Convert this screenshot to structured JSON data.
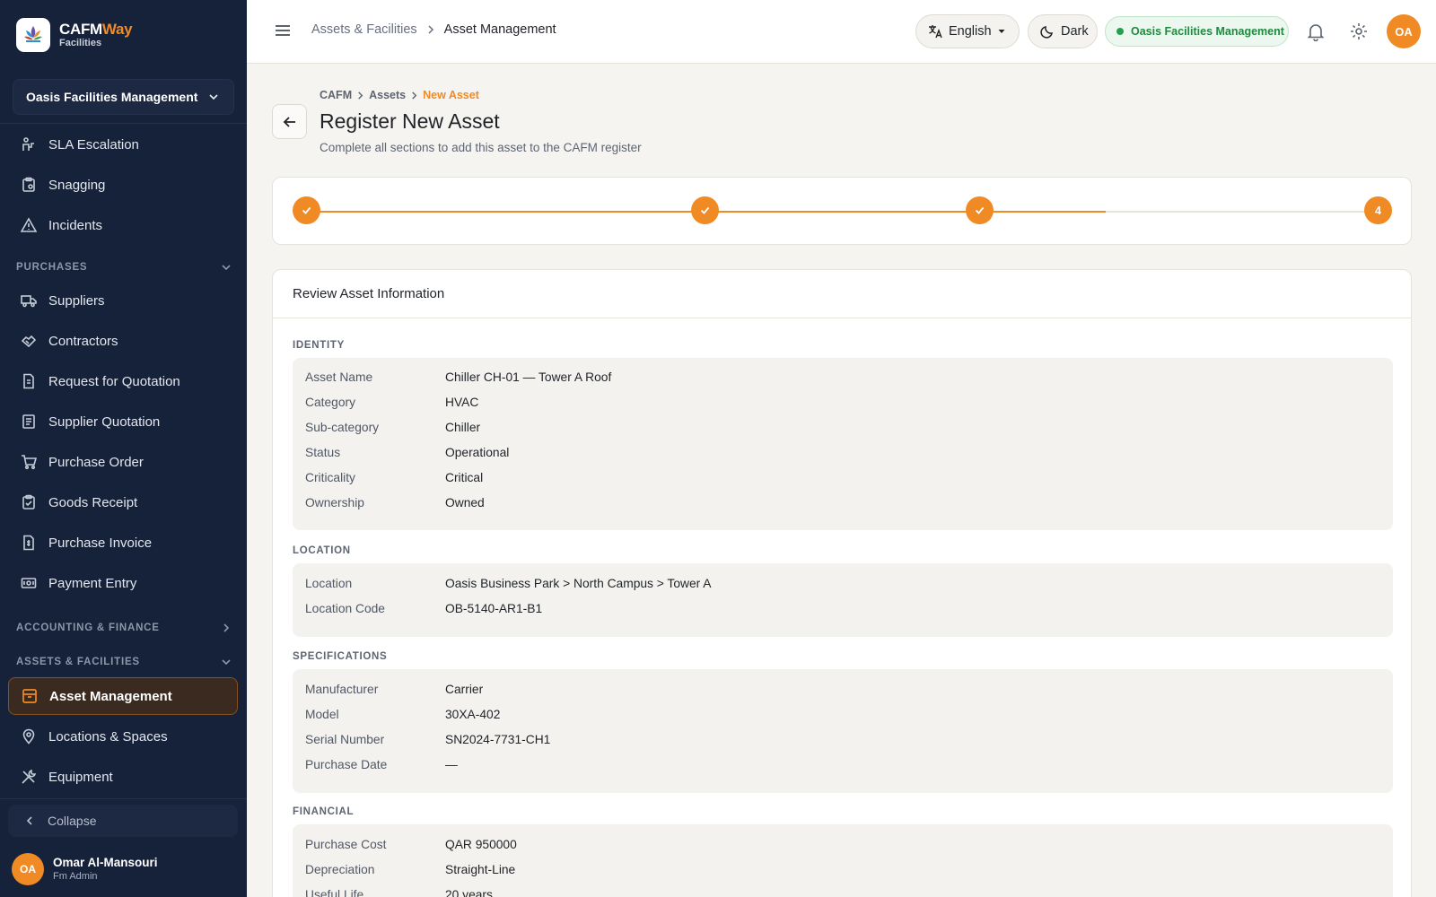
{
  "brand": {
    "name_part1": "CAFM",
    "name_part2": "Way",
    "subtitle": "Facilities"
  },
  "sidebar": {
    "org_selector": "Oasis Facilities Management",
    "items_top": [
      {
        "label": "SLA Escalation",
        "icon": "escalation-icon"
      },
      {
        "label": "Snagging",
        "icon": "clipboard-icon"
      },
      {
        "label": "Incidents",
        "icon": "warning-icon"
      }
    ],
    "purchases_header": "PURCHASES",
    "purchases_items": [
      {
        "label": "Suppliers",
        "icon": "truck-icon"
      },
      {
        "label": "Contractors",
        "icon": "handshake-icon"
      },
      {
        "label": "Request for Quotation",
        "icon": "document-icon"
      },
      {
        "label": "Supplier Quotation",
        "icon": "receipt-icon"
      },
      {
        "label": "Purchase Order",
        "icon": "cart-icon"
      },
      {
        "label": "Goods Receipt",
        "icon": "clipboard-check-icon"
      },
      {
        "label": "Purchase Invoice",
        "icon": "invoice-icon"
      },
      {
        "label": "Payment Entry",
        "icon": "payment-icon"
      }
    ],
    "accounting_header": "ACCOUNTING & FINANCE",
    "assets_header": "ASSETS & FACILITIES",
    "assets_items": [
      {
        "label": "Asset Management",
        "icon": "archive-icon",
        "active": true
      },
      {
        "label": "Locations & Spaces",
        "icon": "location-pin-icon"
      },
      {
        "label": "Equipment",
        "icon": "tools-icon"
      }
    ],
    "collapse_label": "Collapse",
    "user": {
      "initials": "OA",
      "name": "Omar Al-Mansouri",
      "role": "Fm Admin"
    }
  },
  "topbar": {
    "breadcrumb_parent": "Assets & Facilities",
    "breadcrumb_current": "Asset Management",
    "language": "English",
    "theme_label": "Dark",
    "org_badge": "Oasis Facilities Management",
    "avatar_initials": "OA"
  },
  "page": {
    "crumb1": "CAFM",
    "crumb2": "Assets",
    "crumb3": "New Asset",
    "title": "Register New Asset",
    "subtitle": "Complete all sections to add this asset to the CAFM register"
  },
  "stepper": {
    "completed_steps": 3,
    "current_step_label": "4",
    "accent": "#f08a24"
  },
  "review": {
    "title": "Review Asset Information",
    "sections": {
      "identity": {
        "label": "IDENTITY",
        "rows": [
          {
            "k": "Asset Name",
            "v": "Chiller CH-01 — Tower A Roof"
          },
          {
            "k": "Category",
            "v": "HVAC"
          },
          {
            "k": "Sub-category",
            "v": "Chiller"
          },
          {
            "k": "Status",
            "v": "Operational"
          },
          {
            "k": "Criticality",
            "v": "Critical"
          },
          {
            "k": "Ownership",
            "v": "Owned"
          }
        ]
      },
      "location": {
        "label": "LOCATION",
        "rows": [
          {
            "k": "Location",
            "v": "Oasis Business Park > North Campus > Tower A"
          },
          {
            "k": "Location Code",
            "v": "OB-5140-AR1-B1"
          }
        ]
      },
      "specifications": {
        "label": "SPECIFICATIONS",
        "rows": [
          {
            "k": "Manufacturer",
            "v": "Carrier"
          },
          {
            "k": "Model",
            "v": "30XA-402"
          },
          {
            "k": "Serial Number",
            "v": "SN2024-7731-CH1"
          },
          {
            "k": "Purchase Date",
            "v": "—"
          }
        ]
      },
      "financial": {
        "label": "FINANCIAL",
        "rows": [
          {
            "k": "Purchase Cost",
            "v": "QAR 950000"
          },
          {
            "k": "Depreciation",
            "v": "Straight-Line"
          },
          {
            "k": "Useful Life",
            "v": "20 years"
          }
        ]
      }
    }
  }
}
